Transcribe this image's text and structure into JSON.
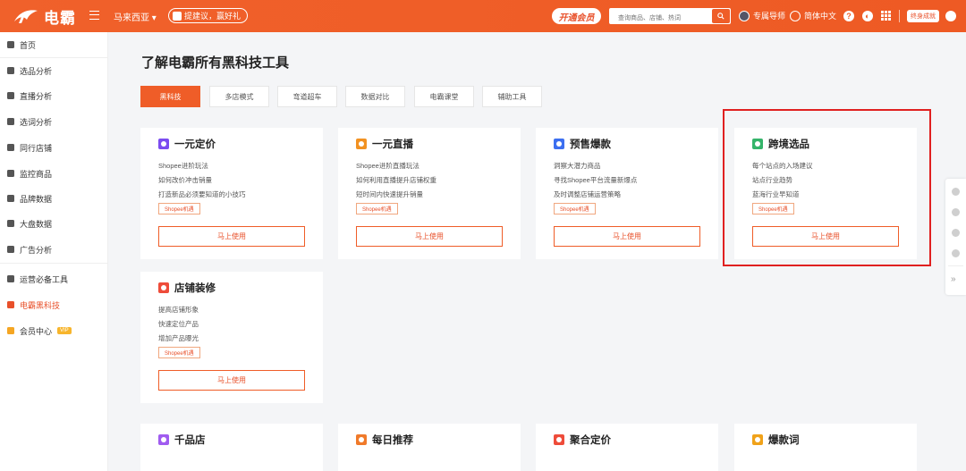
{
  "brand": {
    "name": "电霸"
  },
  "topbar": {
    "region": "马来西亚",
    "feedback": "提建议，赢好礼",
    "vip_button": "开通会员",
    "search_placeholder": "查询商品、店铺、热词",
    "advisor": "专属导师",
    "language": "简体中文",
    "growth": "终身成就",
    "accent_color": "#ef5d28"
  },
  "sidebar": {
    "items": [
      {
        "label": "首页",
        "icon": "home-icon"
      },
      {
        "label": "选品分析",
        "icon": "product-icon"
      },
      {
        "label": "直播分析",
        "icon": "live-icon"
      },
      {
        "label": "选词分析",
        "icon": "keyword-icon"
      },
      {
        "label": "同行店铺",
        "icon": "shop-icon"
      },
      {
        "label": "监控商品",
        "icon": "monitor-icon"
      },
      {
        "label": "品牌数据",
        "icon": "brand-icon"
      },
      {
        "label": "大盘数据",
        "icon": "market-icon"
      },
      {
        "label": "广告分析",
        "icon": "ads-icon"
      },
      {
        "label": "运营必备工具",
        "icon": "rocket-icon"
      },
      {
        "label": "电霸黑科技",
        "icon": "apps-icon",
        "active": true
      },
      {
        "label": "会员中心",
        "icon": "crown-icon",
        "tag": "VIP"
      }
    ]
  },
  "main": {
    "title": "了解电霸所有黑科技工具",
    "tabs": [
      {
        "label": "黑科技",
        "active": true
      },
      {
        "label": "多店模式"
      },
      {
        "label": "弯道超车"
      },
      {
        "label": "数据对比"
      },
      {
        "label": "电霸课堂"
      },
      {
        "label": "辅助工具"
      }
    ],
    "cards": [
      {
        "title": "一元定价",
        "icon_color": "#7b4cf0",
        "lines": [
          "Shopee进阶玩法",
          "如何改价冲击销量",
          "打造新品必须要知道的小技巧"
        ],
        "tag": "Shopee机遇",
        "button": "马上使用"
      },
      {
        "title": "一元直播",
        "icon_color": "#f29222",
        "lines": [
          "Shopee进阶直播玩法",
          "如何利用直播提升店铺权重",
          "短时间内快速提升销量"
        ],
        "tag": "Shopee机遇",
        "button": "马上使用"
      },
      {
        "title": "预售爆款",
        "icon_color": "#3c6ff0",
        "lines": [
          "洞察大潜力商品",
          "寻找Shopee平台流量新爆点",
          "及时调整店铺运营策略"
        ],
        "tag": "Shopee机遇",
        "button": "马上使用"
      },
      {
        "title": "跨境选品",
        "icon_color": "#35b46a",
        "lines": [
          "每个站点的入场建议",
          "站点行业趋势",
          "蓝海行业早知道"
        ],
        "tag": "Shopee机遇",
        "button": "马上使用"
      },
      {
        "title": "店铺装修",
        "icon_color": "#ee4c3a",
        "lines": [
          "提高店铺形象",
          "快速定位产品",
          "增加产品曝光"
        ],
        "tag": "Shopee机遇",
        "button": "马上使用"
      },
      {
        "title": "千品店",
        "icon_color": "#a05cf0"
      },
      {
        "title": "每日推荐",
        "icon_color": "#f07a2a"
      },
      {
        "title": "聚合定价",
        "icon_color": "#ee4c3a"
      },
      {
        "title": "爆款词",
        "icon_color": "#f0a21a"
      }
    ]
  }
}
